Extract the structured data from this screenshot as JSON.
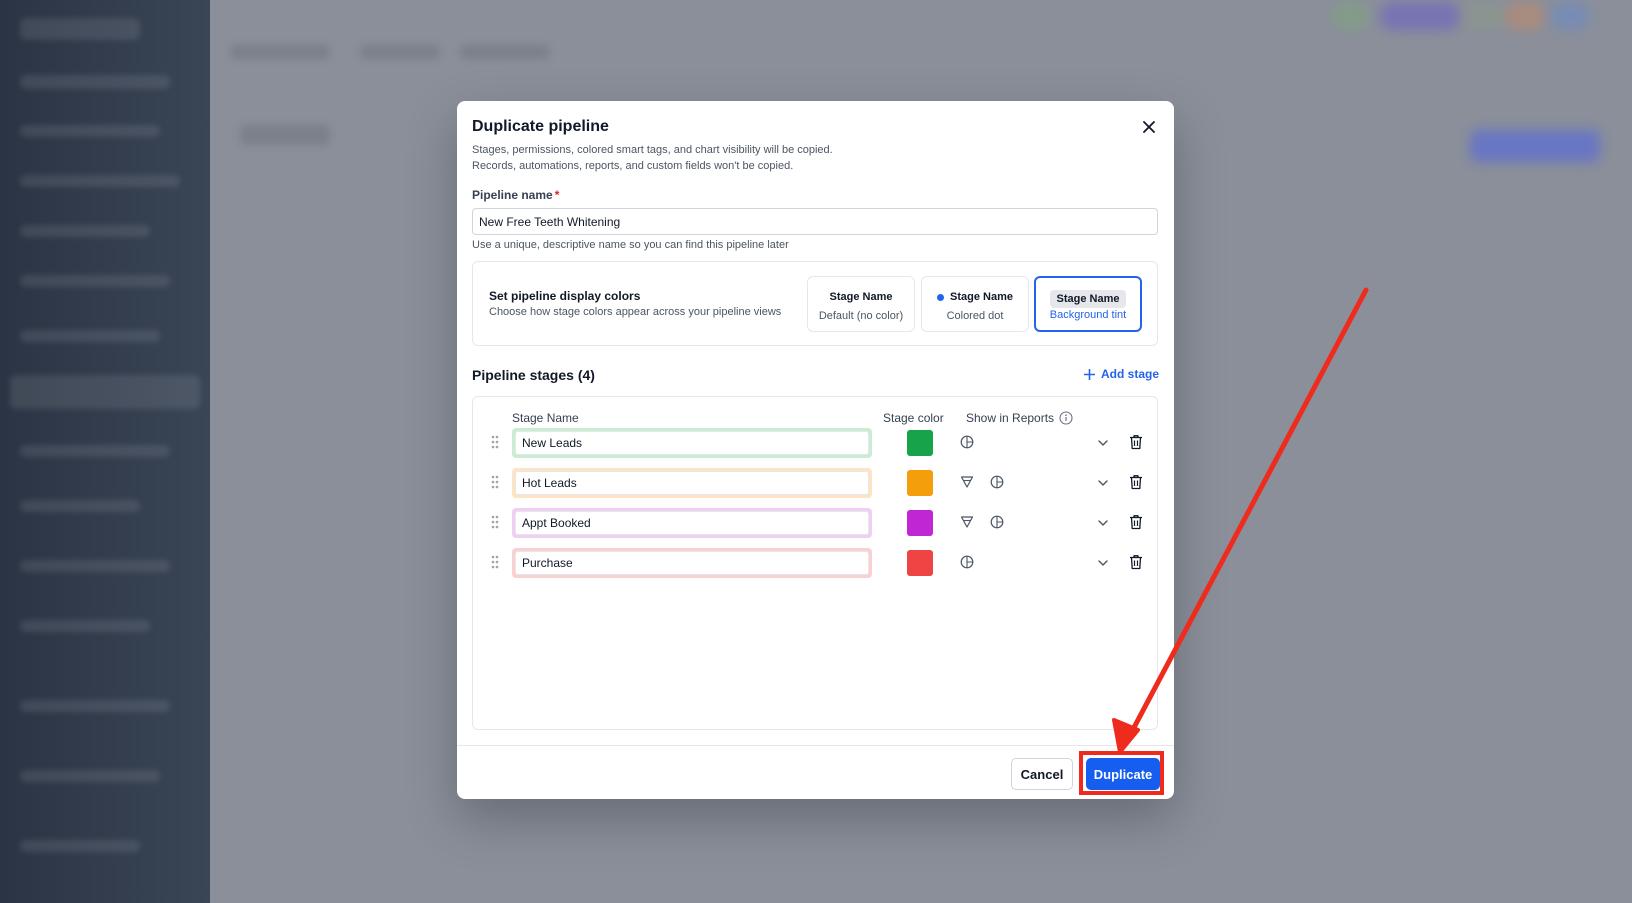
{
  "modal": {
    "title": "Duplicate pipeline",
    "description_line1": "Stages, permissions, colored smart tags, and chart visibility will be copied.",
    "description_line2": "Records, automations, reports, and custom fields won't be copied.",
    "close_icon": "close-icon"
  },
  "pipeline_name": {
    "label": "Pipeline name",
    "required_mark": "*",
    "value": "New Free Teeth Whitening",
    "hint": "Use a unique, descriptive name so you can find this pipeline later"
  },
  "display_colors": {
    "title": "Set pipeline display colors",
    "subtitle": "Choose how stage colors appear across your pipeline views",
    "options": [
      {
        "title": "Stage Name",
        "sub": "Default (no color)",
        "selected": false
      },
      {
        "title": "Stage Name",
        "sub": "Colored dot",
        "selected": false
      },
      {
        "title": "Stage Name",
        "sub": "Background tint",
        "selected": true
      }
    ]
  },
  "stages": {
    "heading": "Pipeline stages (4)",
    "add_label": "Add stage",
    "columns": {
      "name": "Stage Name",
      "color": "Stage color",
      "reports": "Show in Reports"
    },
    "items": [
      {
        "name": "New Leads",
        "color": "#16a34a",
        "tint": "#c9ecd3",
        "funnel": false
      },
      {
        "name": "Hot Leads",
        "color": "#f59e0b",
        "tint": "#fde4c2",
        "funnel": true
      },
      {
        "name": "Appt Booked",
        "color": "#c026d3",
        "tint": "#f0cff4",
        "funnel": true
      },
      {
        "name": "Purchase",
        "color": "#ef4444",
        "tint": "#fbd0d0",
        "funnel": false
      }
    ]
  },
  "footer": {
    "cancel_label": "Cancel",
    "duplicate_label": "Duplicate"
  },
  "colors": {
    "primary": "#155eef",
    "annotation": "#ef2b1d"
  }
}
